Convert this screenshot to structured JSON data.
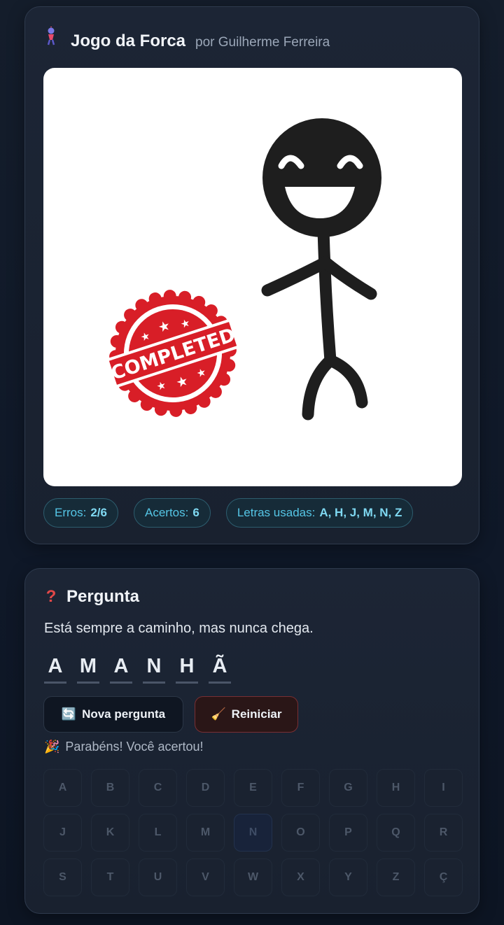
{
  "header": {
    "icon": "hangman-icon",
    "title": "Jogo da Forca",
    "subtitle": "por Guilherme Ferreira"
  },
  "canvas": {
    "stamp_text": "COMPLETED",
    "stamp_color": "#d81e27"
  },
  "stats": {
    "errors_label": "Erros:",
    "errors_value": "2/6",
    "hits_label": "Acertos:",
    "hits_value": "6",
    "used_label": "Letras usadas:",
    "used_value": "A, H, J, M, N, Z"
  },
  "question": {
    "icon": "question-mark-icon",
    "title": "Pergunta",
    "text": "Está sempre a caminho, mas nunca chega.",
    "word": [
      "A",
      "M",
      "A",
      "N",
      "H",
      "Ã"
    ]
  },
  "buttons": {
    "new_icon": "🔄",
    "new_label": "Nova pergunta",
    "reset_icon": "🧹",
    "reset_label": "Reiniciar"
  },
  "status": {
    "icon": "🎉",
    "message": "Parabéns! Você acertou!"
  },
  "keyboard": {
    "keys": [
      "A",
      "B",
      "C",
      "D",
      "E",
      "F",
      "G",
      "H",
      "I",
      "J",
      "K",
      "L",
      "M",
      "N",
      "O",
      "P",
      "Q",
      "R",
      "S",
      "T",
      "U",
      "V",
      "W",
      "X",
      "Y",
      "Z",
      "Ç"
    ]
  },
  "colors": {
    "accent": "#55c6e6",
    "danger": "#7a2f33",
    "stickman": "#1e1e1e"
  }
}
